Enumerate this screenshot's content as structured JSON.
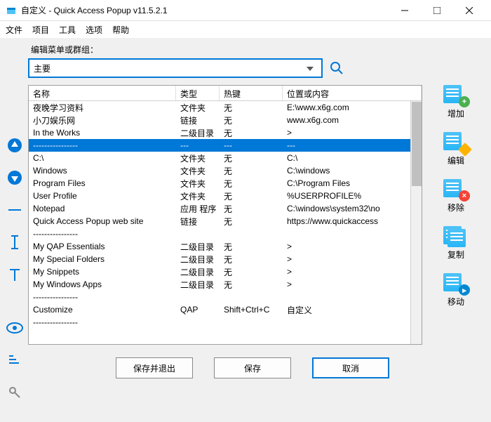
{
  "window": {
    "title": "自定义 - Quick Access Popup v11.5.2.1"
  },
  "menubar": {
    "items": [
      "文件",
      "项目",
      "工具",
      "选项",
      "帮助"
    ]
  },
  "editor": {
    "label": "编辑菜单或群组：",
    "dropdown_value": "主要"
  },
  "table": {
    "headers": {
      "name": "名称",
      "type": "类型",
      "hotkey": "热键",
      "location": "位置或内容"
    },
    "rows": [
      {
        "name": "夜晚学习资料",
        "type": "文件夹",
        "hotkey": "无",
        "loc": "E:\\www.x6g.com",
        "selected": false
      },
      {
        "name": "小刀娱乐网",
        "type": "链接",
        "hotkey": "无",
        "loc": "www.x6g.com",
        "selected": false
      },
      {
        "name": "In the Works",
        "type": "二级目录",
        "hotkey": "无",
        "loc": ">",
        "selected": false
      },
      {
        "name": "----------------",
        "type": "---",
        "hotkey": "---",
        "loc": "---",
        "selected": true
      },
      {
        "name": "C:\\",
        "type": "文件夹",
        "hotkey": "无",
        "loc": "C:\\",
        "selected": false
      },
      {
        "name": "Windows",
        "type": "文件夹",
        "hotkey": "无",
        "loc": "C:\\windows",
        "selected": false
      },
      {
        "name": "Program Files",
        "type": "文件夹",
        "hotkey": "无",
        "loc": "C:\\Program Files",
        "selected": false
      },
      {
        "name": "User Profile",
        "type": "文件夹",
        "hotkey": "无",
        "loc": "%USERPROFILE%",
        "selected": false
      },
      {
        "name": "Notepad",
        "type": "应用 程序",
        "hotkey": "无",
        "loc": "C:\\windows\\system32\\no",
        "selected": false
      },
      {
        "name": "Quick Access Popup web site",
        "type": "链接",
        "hotkey": "无",
        "loc": "https://www.quickaccess",
        "selected": false
      },
      {
        "name": "----------------",
        "type": "",
        "hotkey": "",
        "loc": "",
        "selected": false
      },
      {
        "name": "My QAP Essentials",
        "type": "二级目录",
        "hotkey": "无",
        "loc": ">",
        "selected": false
      },
      {
        "name": "My Special Folders",
        "type": "二级目录",
        "hotkey": "无",
        "loc": ">",
        "selected": false
      },
      {
        "name": "My Snippets",
        "type": "二级目录",
        "hotkey": "无",
        "loc": ">",
        "selected": false
      },
      {
        "name": "My Windows Apps",
        "type": "二级目录",
        "hotkey": "无",
        "loc": ">",
        "selected": false
      },
      {
        "name": "----------------",
        "type": "",
        "hotkey": "",
        "loc": "",
        "selected": false
      },
      {
        "name": "Customize",
        "type": "QAP",
        "hotkey": "Shift+Ctrl+C",
        "loc": "自定义",
        "selected": false
      },
      {
        "name": "----------------",
        "type": "",
        "hotkey": "",
        "loc": "",
        "selected": false
      }
    ]
  },
  "right_tools": {
    "add": "增加",
    "edit": "编辑",
    "remove": "移除",
    "copy": "复制",
    "move": "移动"
  },
  "buttons": {
    "save_exit": "保存并退出",
    "save": "保存",
    "cancel": "取消"
  }
}
